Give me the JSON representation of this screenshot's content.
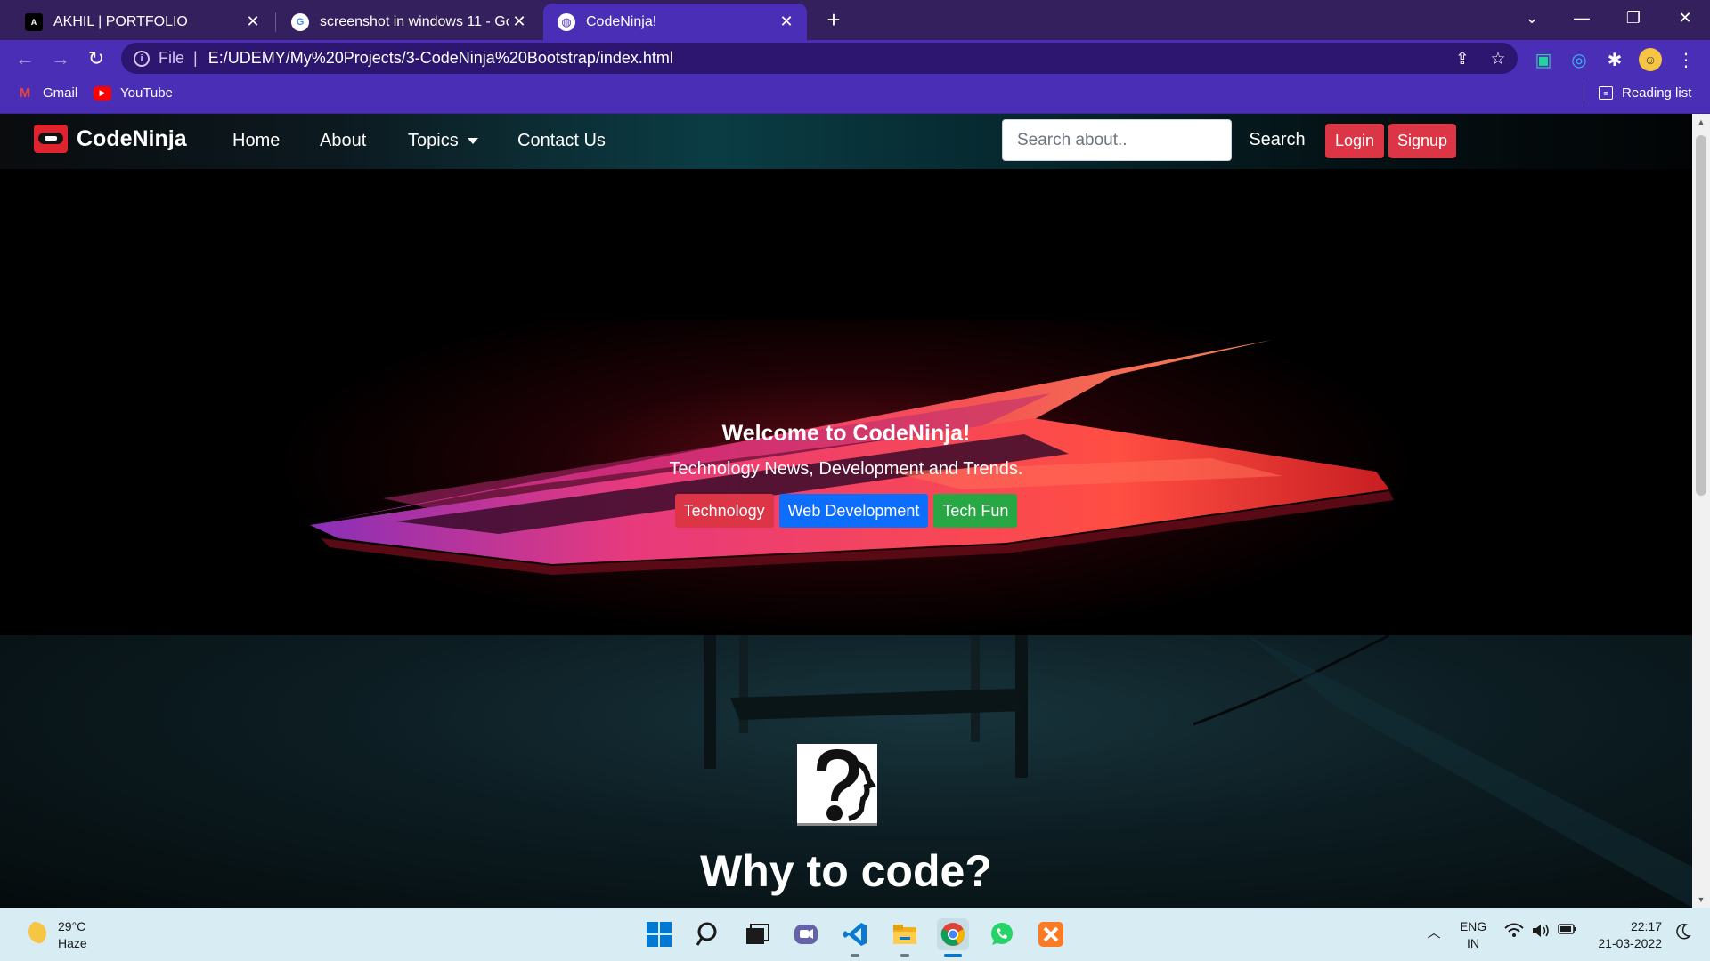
{
  "browser": {
    "tabs": [
      {
        "label": "AKHIL | PORTFOLIO",
        "icon": "portfolio-favicon"
      },
      {
        "label": "screenshot in windows 11 - Goog",
        "icon": "google-favicon"
      },
      {
        "label": "CodeNinja!",
        "icon": "globe-icon"
      }
    ],
    "address": {
      "scheme": "File",
      "url": "E:/UDEMY/My%20Projects/3-CodeNinja%20Bootstrap/index.html"
    },
    "bookmarks": [
      {
        "label": "Gmail",
        "icon": "gmail-icon"
      },
      {
        "label": "YouTube",
        "icon": "youtube-icon"
      }
    ],
    "reading_list": "Reading list"
  },
  "site": {
    "brand": "CodeNinja",
    "nav": {
      "home": "Home",
      "about": "About",
      "topics": "Topics",
      "contact": "Contact Us"
    },
    "search": {
      "placeholder": "Search about..",
      "button": "Search"
    },
    "login": "Login",
    "signup": "Signup",
    "hero": {
      "title": "Welcome to CodeNinja!",
      "subtitle": "Technology News, Development and Trends.",
      "buttons": [
        {
          "label": "Technology",
          "color": "#dc3545"
        },
        {
          "label": "Web Development",
          "color": "#0d6efd"
        },
        {
          "label": "Tech Fun",
          "color": "#28a745"
        }
      ]
    },
    "section_heading": "Why to code?"
  },
  "taskbar": {
    "weather": {
      "temp": "29°C",
      "condition": "Haze"
    },
    "lang": {
      "line1": "ENG",
      "line2": "IN"
    },
    "clock": {
      "time": "22:17",
      "date": "21-03-2022"
    }
  }
}
